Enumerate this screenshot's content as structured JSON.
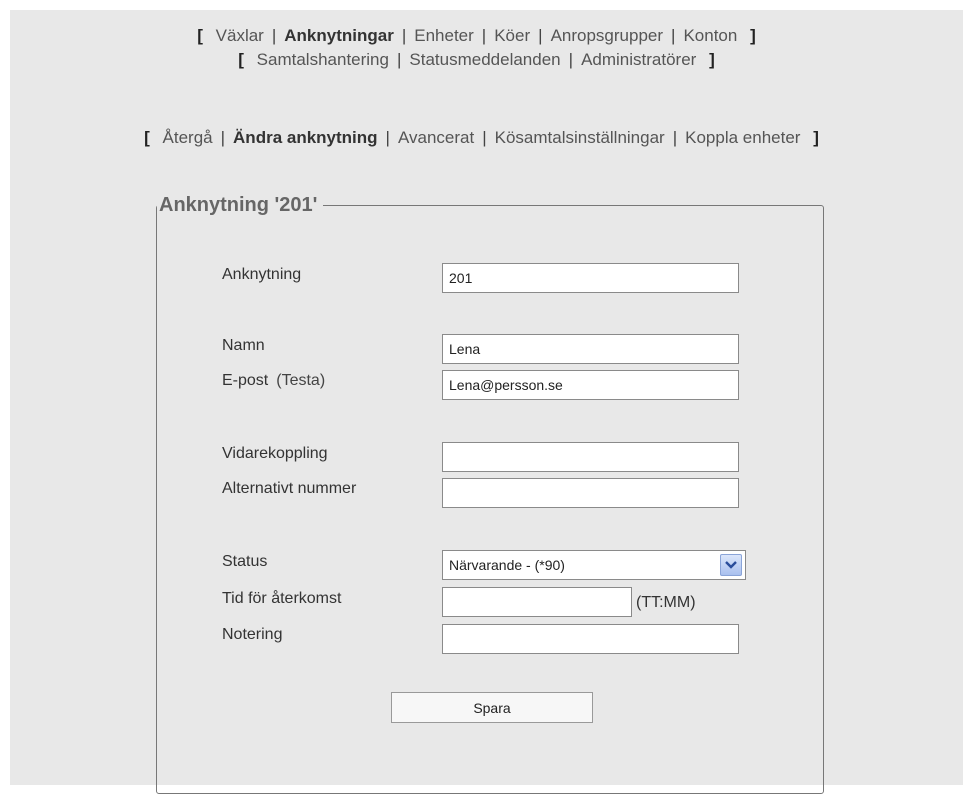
{
  "nav_main": {
    "row1": [
      "Växlar",
      "Anknytningar",
      "Enheter",
      "Köer",
      "Anropsgrupper",
      "Konton"
    ],
    "row2": [
      "Samtalshantering",
      "Statusmeddelanden",
      "Administratörer"
    ],
    "active": "Anknytningar"
  },
  "nav_sub": {
    "items": [
      "Återgå",
      "Ändra anknytning",
      "Avancerat",
      "Kösamtalsinställningar",
      "Koppla enheter"
    ],
    "active": "Ändra anknytning"
  },
  "form": {
    "legend": "Anknytning '201'",
    "extension": {
      "label": "Anknytning",
      "value": "201"
    },
    "name": {
      "label": "Namn",
      "value": "Lena"
    },
    "email": {
      "label": "E-post",
      "test_link": "(Testa)",
      "value": "Lena@persson.se"
    },
    "forwarding": {
      "label": "Vidarekoppling",
      "value": ""
    },
    "alt_number": {
      "label": "Alternativt nummer",
      "value": ""
    },
    "status": {
      "label": "Status",
      "value": "Närvarande - (*90)"
    },
    "return_time": {
      "label": "Tid för återkomst",
      "value": "",
      "hint": "(TT:MM)"
    },
    "note": {
      "label": "Notering",
      "value": ""
    },
    "save_label": "Spara"
  }
}
